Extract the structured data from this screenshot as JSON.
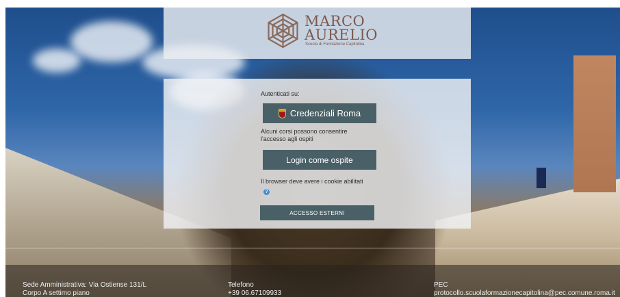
{
  "logo": {
    "title_line1": "MARCO",
    "title_line2": "AURELIO",
    "subtitle": "Scuola di Formazione Capitolina",
    "brand_color": "#7a5a4c"
  },
  "login": {
    "auth_label": "Autenticati su:",
    "roma_button": "Credenziali Roma",
    "guest_note_line1": "Alcuni corsi possono consentire",
    "guest_note_line2": "l'accesso agli ospiti",
    "guest_button": "Login come ospite",
    "cookie_note": "Il browser deve avere i cookie abilitati",
    "help_icon": "question-icon",
    "external_button": "ACCESSO ESTERNI",
    "button_color": "#4a6067"
  },
  "footer": {
    "address_line1": "Sede Amministrativa: Via Ostiense 131/L",
    "address_line2": "Corpo A settimo piano",
    "phone_label": "Telefono",
    "phone_value": "+39 06.67109933",
    "pec_label": "PEC",
    "pec_value": "protocollo.scuolaformazionecapitolina@pec.comune.roma.it"
  }
}
